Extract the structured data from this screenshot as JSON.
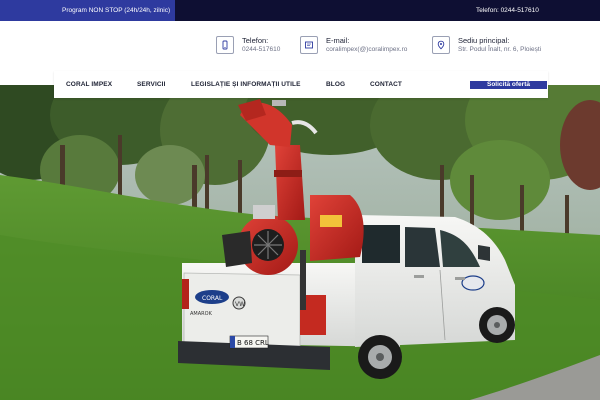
{
  "topbar": {
    "left_text": "Program NON STOP (24h/24h, zilnic)",
    "right_text": "Telefon: 0244-517610"
  },
  "contacts": [
    {
      "icon": "phone-icon",
      "title": "Telefon:",
      "value": "0244-517610"
    },
    {
      "icon": "email-icon",
      "title": "E-mail:",
      "value": "coralimpex(@)coralimpex.ro"
    },
    {
      "icon": "location-pin-icon",
      "title": "Sediu principal:",
      "value": "Str. Podul Înalt, nr. 6, Ploiești"
    }
  ],
  "nav": {
    "items": [
      "CORAL IMPEX",
      "SERVICII",
      "LEGISLAȚIE ȘI INFORMAȚII UTILE",
      "BLOG",
      "CONTACT"
    ],
    "cta": "Solicită ofertă"
  },
  "hero": {
    "truck_logo_text": "CORAL",
    "plate_text": "B 68 CRL",
    "badge_text": "AMAROK"
  },
  "colors": {
    "topbar_bg": "#0e0f33",
    "accent": "#2e3a9f",
    "text_dark": "#1d2133",
    "text_muted": "#6d7186"
  }
}
